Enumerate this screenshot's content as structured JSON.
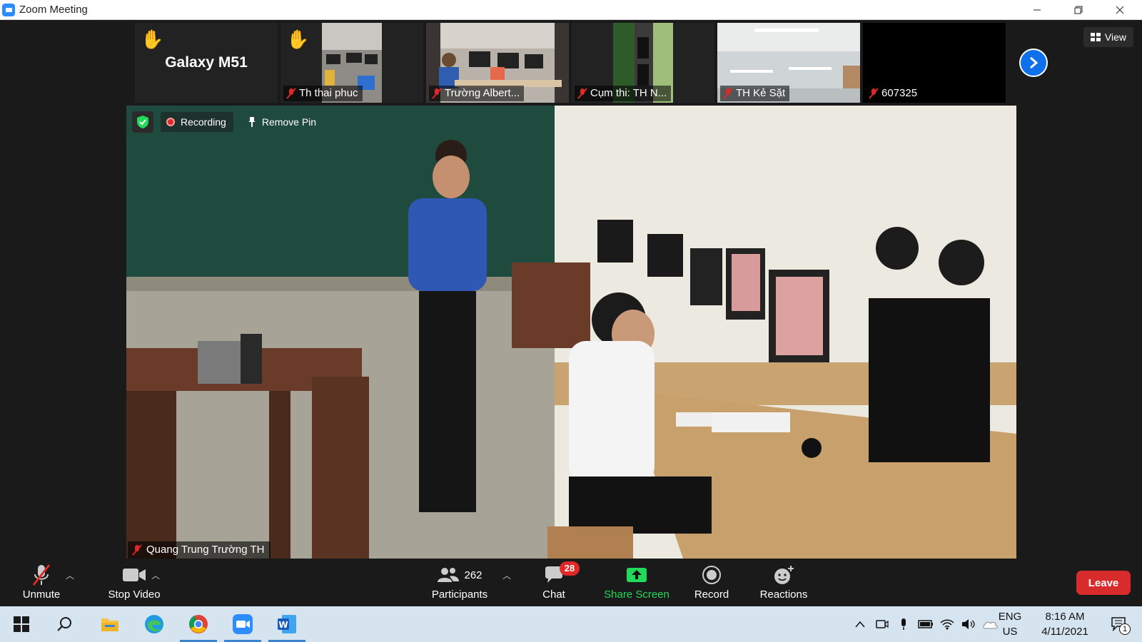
{
  "window": {
    "title": "Zoom Meeting",
    "controls": {
      "minimize": "minimize-icon",
      "restore": "restore-icon",
      "close": "close-icon"
    }
  },
  "view_button": {
    "label": "View"
  },
  "participants_strip": [
    {
      "name": "Galaxy M51",
      "hand_raised": true,
      "video": false,
      "muted": false
    },
    {
      "name": "Th thai phuc",
      "hand_raised": true,
      "video": true,
      "muted": true
    },
    {
      "name": "Trường Albert...",
      "hand_raised": false,
      "video": true,
      "muted": true
    },
    {
      "name": "Cụm thi: TH N...",
      "hand_raised": false,
      "video": true,
      "muted": true
    },
    {
      "name": "TH Kẻ Sặt",
      "hand_raised": false,
      "video": true,
      "muted": true
    },
    {
      "name": "607325",
      "hand_raised": false,
      "video": false,
      "muted": true
    }
  ],
  "main_video": {
    "speaker_name": "Quang Trung Trường TH",
    "recording_label": "Recording",
    "remove_pin_label": "Remove Pin"
  },
  "toolbar": {
    "unmute": "Unmute",
    "stop_video": "Stop Video",
    "participants": "Participants",
    "participants_count": "262",
    "chat": "Chat",
    "chat_badge": "28",
    "share_screen": "Share Screen",
    "record": "Record",
    "reactions": "Reactions",
    "leave": "Leave"
  },
  "taskbar": {
    "language_top": "ENG",
    "language_bottom": "US",
    "time": "8:16 AM",
    "date": "4/11/2021",
    "notification_count": "1"
  },
  "colors": {
    "zoom_blue": "#2d8cff",
    "share_green": "#23d959",
    "leave_red": "#d82c2c",
    "muted_red": "#e02828"
  }
}
